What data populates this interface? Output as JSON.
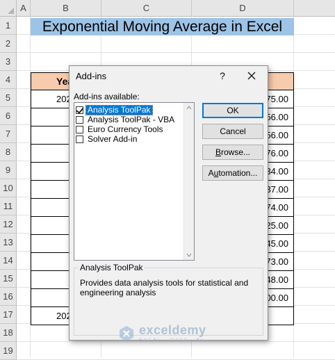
{
  "sheet": {
    "columns": [
      "A",
      "B",
      "C",
      "D"
    ],
    "rows": [
      "1",
      "2",
      "3",
      "4",
      "5",
      "6",
      "7",
      "8",
      "9",
      "10",
      "11",
      "12",
      "13",
      "14",
      "15",
      "16",
      "17",
      "18",
      "19"
    ],
    "title": "Exponential Moving Average in Excel",
    "header_year": "Yea",
    "year_cells": [
      "202",
      "",
      "",
      "",
      "",
      "",
      "",
      "",
      "",
      "",
      "",
      "",
      "202"
    ],
    "value_cells": [
      "75.00",
      "56.00",
      "56.00",
      "76.00",
      "34.00",
      "37.00",
      "74.00",
      "25.00",
      "45.00",
      "73.00",
      "48.00",
      "00.00",
      ""
    ]
  },
  "dialog": {
    "title": "Add-ins",
    "help_label": "?",
    "available_label": "Add-ins available:",
    "addins": [
      {
        "label": "Analysis ToolPak",
        "checked": true,
        "selected": true
      },
      {
        "label": "Analysis ToolPak - VBA",
        "checked": false,
        "selected": false
      },
      {
        "label": "Euro Currency Tools",
        "checked": false,
        "selected": false
      },
      {
        "label": "Solver Add-in",
        "checked": false,
        "selected": false
      }
    ],
    "buttons": {
      "ok": "OK",
      "cancel": "Cancel",
      "browse_hot": "B",
      "browse_rest": "rowse...",
      "automation_pre": "A",
      "automation_hot": "u",
      "automation_rest": "tomation..."
    },
    "description_title": "Analysis ToolPak",
    "description": "Provides data analysis tools for statistical and engineering analysis"
  },
  "watermark": {
    "name": "exceldemy",
    "tagline": "EXCEL · DATA · BI"
  },
  "colors": {
    "title_fill": "#9dc3e6",
    "header_fill": "#f8cbad",
    "selection": "#0078d7"
  }
}
